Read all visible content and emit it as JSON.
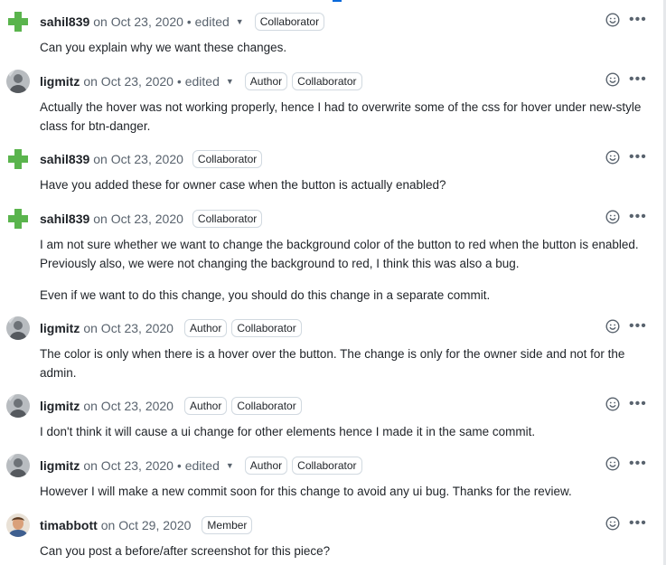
{
  "comments": [
    {
      "author": "sahil839",
      "date": "on Oct 23, 2020",
      "edited": "edited",
      "badges": [
        "Collaborator"
      ],
      "body": [
        "Can you explain why we want these changes."
      ]
    },
    {
      "author": "ligmitz",
      "date": "on Oct 23, 2020",
      "edited": "edited",
      "badges": [
        "Author",
        "Collaborator"
      ],
      "body": [
        "Actually the hover was not working properly, hence I had to overwrite some of the css for hover under new-style class for btn-danger."
      ]
    },
    {
      "author": "sahil839",
      "date": "on Oct 23, 2020",
      "badges": [
        "Collaborator"
      ],
      "body": [
        "Have you added these for owner case when the button is actually enabled?"
      ]
    },
    {
      "author": "sahil839",
      "date": "on Oct 23, 2020",
      "badges": [
        "Collaborator"
      ],
      "body": [
        "I am not sure whether we want to change the background color of the button to red when the button is enabled. Previously also, we were not changing the background to red, I think this was also a bug.",
        "Even if we want to do this change, you should do this change in a separate commit."
      ]
    },
    {
      "author": "ligmitz",
      "date": "on Oct 23, 2020",
      "badges": [
        "Author",
        "Collaborator"
      ],
      "body": [
        "The color is only when there is a hover over the button. The change is only for the owner side and not for the admin."
      ]
    },
    {
      "author": "ligmitz",
      "date": "on Oct 23, 2020",
      "badges": [
        "Author",
        "Collaborator"
      ],
      "body": [
        "I don't think it will cause a ui change for other elements hence I made it in the same commit."
      ]
    },
    {
      "author": "ligmitz",
      "date": "on Oct 23, 2020",
      "edited": "edited",
      "badges": [
        "Author",
        "Collaborator"
      ],
      "body": [
        "However I will make a new commit soon for this change to avoid any ui bug. Thanks for the review."
      ]
    },
    {
      "author": "timabbott",
      "date": "on Oct 29, 2020",
      "badges": [
        "Member"
      ],
      "body": [
        "Can you post a before/after screenshot for this piece?"
      ]
    }
  ],
  "separator": "•",
  "icons": {
    "reaction": "smiley-icon",
    "menu": "kebab-horizontal-icon",
    "edited_menu": "triangle-down-icon"
  },
  "colors": {
    "sahil839_avatar": "#5ab44d",
    "ligmitz_avatar": "#8a8f95",
    "timabbott_avatar": "#b07a55",
    "muted_text": "#59636e",
    "badge_border": "#d1d9e0"
  }
}
